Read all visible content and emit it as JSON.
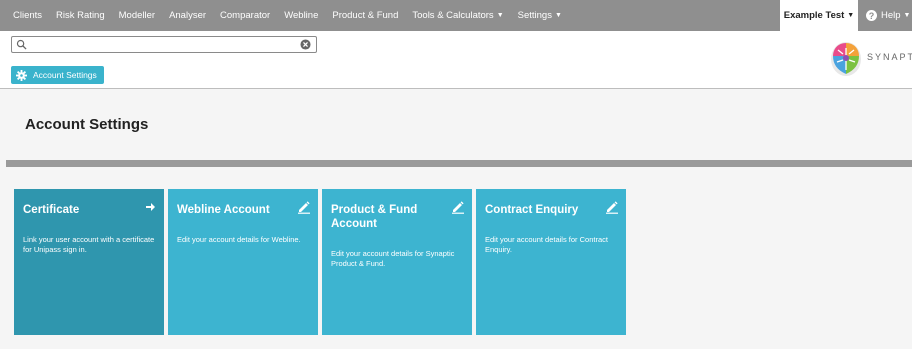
{
  "nav": {
    "items": [
      {
        "label": "Clients",
        "dropdown": false
      },
      {
        "label": "Risk Rating",
        "dropdown": false
      },
      {
        "label": "Modeller",
        "dropdown": false
      },
      {
        "label": "Analyser",
        "dropdown": false
      },
      {
        "label": "Comparator",
        "dropdown": false
      },
      {
        "label": "Webline",
        "dropdown": false
      },
      {
        "label": "Product & Fund",
        "dropdown": false
      },
      {
        "label": "Tools & Calculators",
        "dropdown": true
      },
      {
        "label": "Settings",
        "dropdown": true
      }
    ],
    "user": "Example Test",
    "help": "Help",
    "caret": "▼"
  },
  "search": {
    "value": "",
    "placeholder": ""
  },
  "breadcrumb": {
    "label": "Account Settings"
  },
  "logo": {
    "text": "SYNAPTI"
  },
  "page": {
    "title": "Account Settings"
  },
  "tiles": [
    {
      "title": "Certificate",
      "desc": "Link your user account with a certificate for Unipass sign in.",
      "icon": "arrow-right-icon"
    },
    {
      "title": "Webline Account",
      "desc": "Edit your account details for Webline.",
      "icon": "pencil-icon"
    },
    {
      "title": "Product & Fund Account",
      "desc": "Edit your account details for Synaptic Product & Fund.",
      "icon": "pencil-icon"
    },
    {
      "title": "Contract Enquiry",
      "desc": "Edit your account details for Contract Enquiry.",
      "icon": "pencil-icon"
    }
  ],
  "colors": {
    "nav_bg": "#8f8f8f",
    "accent": "#3ab3cc",
    "tile": "#3db4d0",
    "tile_dark": "#2f96ae",
    "band": "#9a9a9a"
  }
}
